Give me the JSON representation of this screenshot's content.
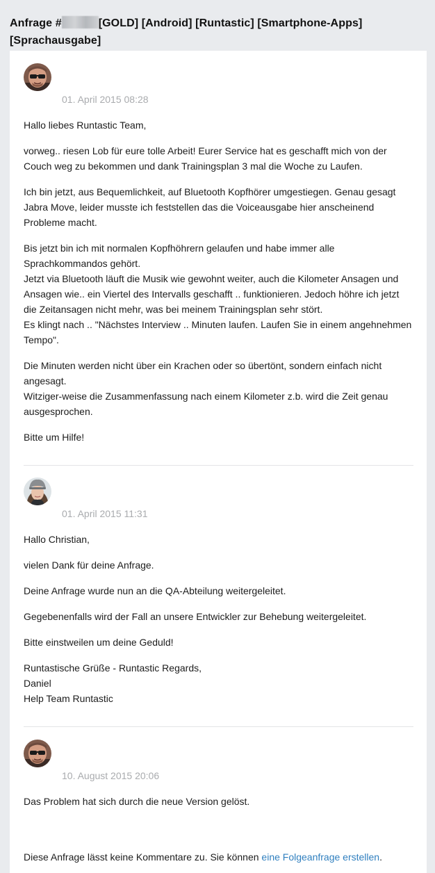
{
  "request": {
    "title_prefix": "Anfrage #",
    "title_rest": "[GOLD] [Android] [Runtastic] [Smartphone-Apps] [Sprachausgabe]"
  },
  "comments": [
    {
      "avatar": "male-user-avatar-icon",
      "date": "01. April 2015 08:28",
      "paragraphs": [
        "Hallo liebes Runtastic Team,",
        "vorweg.. riesen Lob für eure tolle Arbeit! Eurer Service hat es geschafft mich von der Couch weg zu bekommen und dank Trainingsplan 3 mal die Woche zu Laufen.",
        "Ich bin jetzt, aus Bequemlichkeit, auf Bluetooth Kopfhörer umgestiegen. Genau gesagt Jabra Move, leider musste ich feststellen das die Voiceausgabe hier anscheinend Probleme macht.",
        "Bis jetzt bin ich mit normalen Kopfhöhrern gelaufen und habe immer alle Sprachkommandos gehört.\nJetzt via Bluetooth läuft die Musik wie gewohnt weiter, auch die Kilometer Ansagen und Ansagen wie.. ein Viertel des Intervalls geschafft .. funktionieren. Jedoch höhre ich jetzt die Zeitansagen nicht mehr, was bei meinem Trainingsplan sehr stört.\nEs klingt nach .. \"Nächstes Interview .. Minuten laufen. Laufen Sie in einem angehnehmen Tempo\".",
        "Die Minuten werden nicht über ein Krachen oder so übertönt, sondern einfach nicht angesagt.\nWitziger-weise die Zusammenfassung nach einem Kilometer z.b. wird die Zeit genau ausgesprochen.",
        "Bitte um Hilfe!"
      ]
    },
    {
      "avatar": "female-agent-avatar-icon",
      "date": "01. April 2015 11:31",
      "paragraphs": [
        "Hallo Christian,",
        "vielen Dank für deine Anfrage.",
        "Deine Anfrage wurde nun an die QA-Abteilung weitergeleitet.",
        "Gegebenenfalls wird der Fall an unsere Entwickler zur Behebung weitergeleitet.",
        "Bitte einstweilen um deine Geduld!",
        "Runtastische Grüße - Runtastic Regards,\nDaniel\nHelp Team Runtastic"
      ]
    },
    {
      "avatar": "male-user-avatar-icon",
      "date": "10. August 2015 20:06",
      "paragraphs": [
        "Das Problem hat sich durch die neue Version gelöst."
      ]
    }
  ],
  "footer": {
    "text": "Diese Anfrage lässt keine Kommentare zu. Sie können ",
    "link": "eine Folgeanfrage erstellen",
    "end": "."
  },
  "colors": {
    "page_background": "#e9ebee",
    "link": "#2f7fbf",
    "date": "#a9abae"
  }
}
